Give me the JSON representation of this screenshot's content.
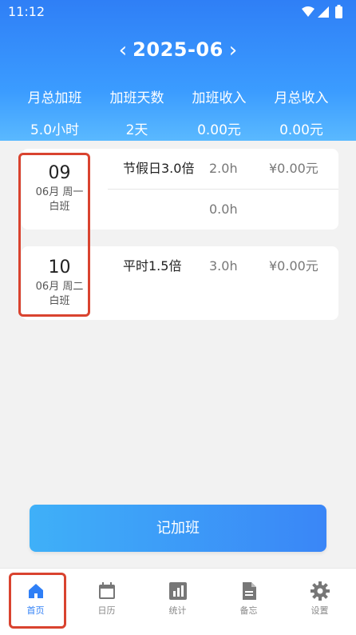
{
  "status_bar": {
    "time": "11:12"
  },
  "month_nav": {
    "prev_icon": "chevron-left-icon",
    "label": "2025-06",
    "next_icon": "chevron-right-icon",
    "prev_glyph": "‹",
    "next_glyph": "›"
  },
  "summary": [
    {
      "label": "月总加班",
      "value": "5.0小时"
    },
    {
      "label": "加班天数",
      "value": "2天"
    },
    {
      "label": "加班收入",
      "value": "0.00元"
    },
    {
      "label": "月总收入",
      "value": "0.00元"
    }
  ],
  "records": [
    {
      "day": "09",
      "sub1": "06月 周一",
      "sub2": "白班",
      "rows": [
        {
          "type": "节假日3.0倍",
          "hours": "2.0h",
          "income": "¥0.00元"
        },
        {
          "type": "",
          "hours": "0.0h",
          "income": ""
        }
      ]
    },
    {
      "day": "10",
      "sub1": "06月 周二",
      "sub2": "白班",
      "rows": [
        {
          "type": "平时1.5倍",
          "hours": "3.0h",
          "income": "¥0.00元"
        }
      ]
    }
  ],
  "record_button": {
    "label": "记加班"
  },
  "tabs": [
    {
      "label": "首页",
      "icon": "home-icon",
      "active": true
    },
    {
      "label": "日历",
      "icon": "calendar-icon",
      "active": false
    },
    {
      "label": "统计",
      "icon": "bar-chart-icon",
      "active": false
    },
    {
      "label": "备忘",
      "icon": "document-icon",
      "active": false
    },
    {
      "label": "设置",
      "icon": "gear-icon",
      "active": false
    }
  ],
  "colors": {
    "primary": "#2f7ff6",
    "highlight": "#d9432f"
  }
}
